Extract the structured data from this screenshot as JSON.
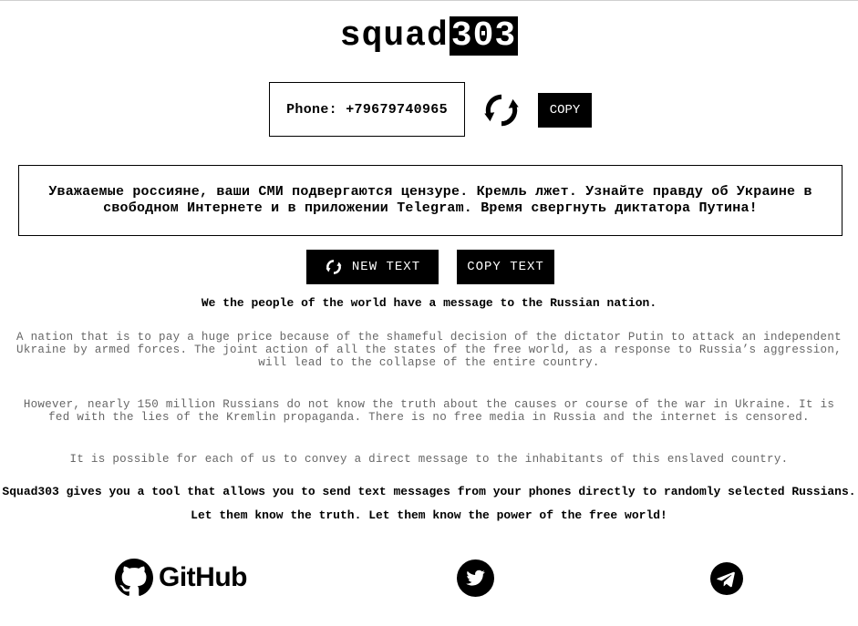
{
  "logo": {
    "word": "squad",
    "number": "303"
  },
  "phone": {
    "label": "Phone:",
    "number": "+79679740965"
  },
  "copy_label": "COPY",
  "message": "Уважаемые россияне, ваши СМИ подвергаются цензуре. Кремль лжет. Узнайте правду об Украине в свободном Интернете и в приложении Telegram. Время свергнуть диктатора Путина!",
  "buttons": {
    "new_text": "NEW TEXT",
    "copy_text": "COPY TEXT"
  },
  "intro": "We the people of the world have a message to the Russian nation.",
  "paragraphs": [
    "A nation that is to pay a huge price because of the shameful decision of the dictator Putin to attack an independent Ukraine by armed forces. The joint action of all the states of the free world, as a response to Russia’s aggression, will lead to the collapse of the entire country.",
    "However, nearly 150 million Russians do not know the truth about the causes or course of the war in Ukraine. It is fed with the lies of the Kremlin propaganda. There is no free media in Russia and the internet is censored.",
    "It is possible for each of us to convey a direct message to the inhabitants of this enslaved country."
  ],
  "bold_lines": [
    "Squad303 gives you a tool that allows you to send text messages from your phones directly to randomly selected Russians.",
    "Let them know the truth. Let them know the power of the free world!"
  ],
  "social": {
    "github_label": "GitHub",
    "icons": [
      "github-icon",
      "twitter-icon",
      "telegram-icon"
    ]
  },
  "colors": {
    "primary": "#000000",
    "background": "#ffffff",
    "muted_text": "#666666"
  }
}
